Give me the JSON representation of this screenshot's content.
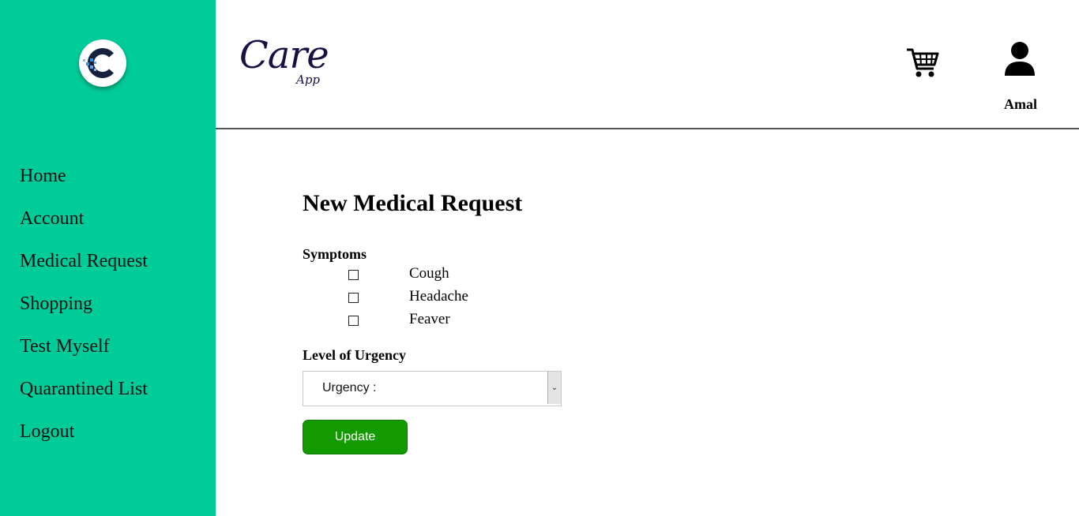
{
  "sidebar": {
    "logo_icon": "care-app-c-logo-icon",
    "items": [
      {
        "label": "Home"
      },
      {
        "label": "Account"
      },
      {
        "label": "Medical Request"
      },
      {
        "label": "Shopping"
      },
      {
        "label": "Test Myself"
      },
      {
        "label": "Quarantined List"
      },
      {
        "label": "Logout"
      }
    ],
    "color": "#00cc99"
  },
  "header": {
    "brand_main": "Care",
    "brand_sub": "App",
    "brand_color": "#1c0f45",
    "cart_icon": "shopping-cart-icon",
    "user_icon": "user-icon",
    "user_name": "Amal"
  },
  "main": {
    "title": "New Medical Request",
    "symptoms_label": "Symptoms",
    "symptoms": [
      {
        "label": "Cough",
        "checked": false
      },
      {
        "label": "Headache",
        "checked": false
      },
      {
        "label": "Feaver",
        "checked": false
      }
    ],
    "urgency_label": "Level of Urgency",
    "urgency_select": {
      "selected": "Urgency :"
    },
    "update_button": "Update",
    "button_color": "#139a00"
  }
}
